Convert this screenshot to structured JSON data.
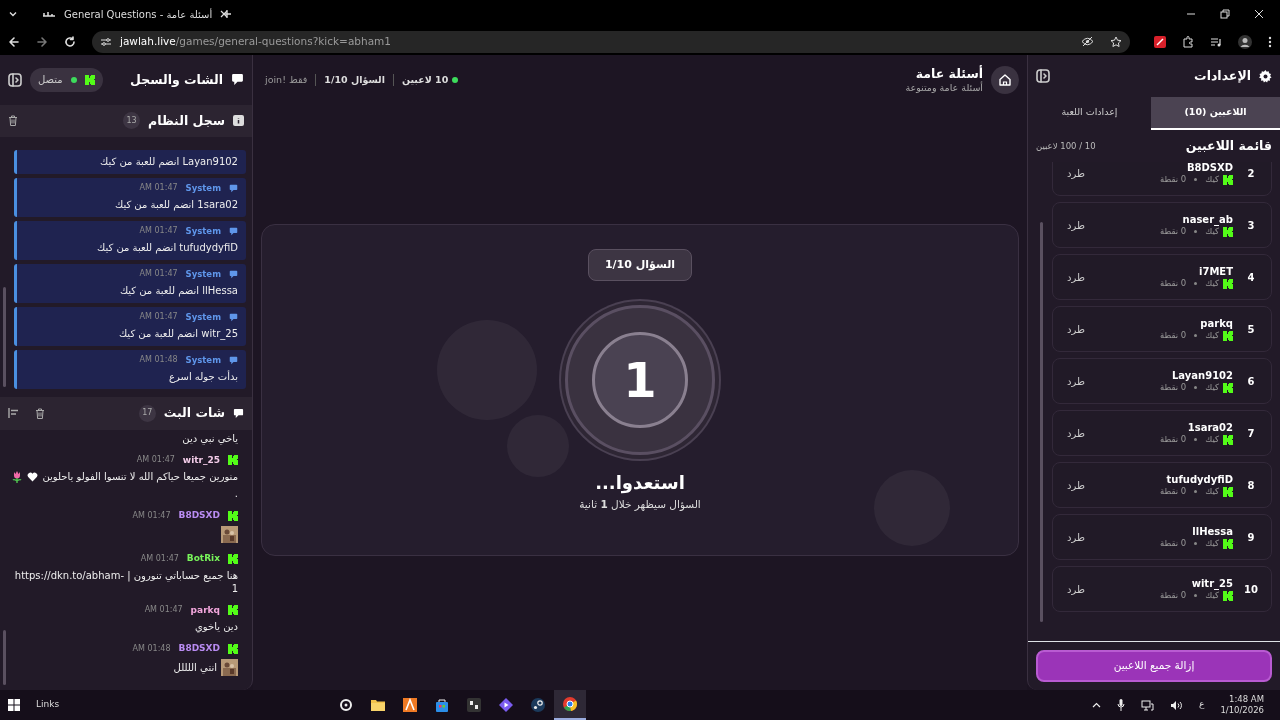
{
  "browser": {
    "tab_title": "General Questions - أسئلة عامة",
    "url_host": "jawlah.live",
    "url_path": "/games/general-questions?kick=abham1"
  },
  "chat_panel": {
    "title": "الشات والسجل",
    "status": {
      "label": "متصل",
      "online": true
    },
    "system_log": {
      "title": "سجل النظام",
      "count": "13",
      "entries": [
        {
          "text": "Layan9102 انضم للعبة من كيك"
        },
        {
          "sender": "System",
          "time": "01:47 AM",
          "text": "1sara02 انضم للعبة من كيك"
        },
        {
          "sender": "System",
          "time": "01:47 AM",
          "text": "tufudydyfiD انضم للعبة من كيك"
        },
        {
          "sender": "System",
          "time": "01:47 AM",
          "text": "llHessa انضم للعبة من كيك"
        },
        {
          "sender": "System",
          "time": "01:47 AM",
          "text": "witr_25 انضم للعبة من كيك"
        },
        {
          "sender": "System",
          "time": "01:48 AM",
          "text": "بدأت جوله اسرع"
        }
      ]
    },
    "stream_chat": {
      "title": "شات البث",
      "count": "17",
      "messages": [
        {
          "parts": [
            {
              "kind": "text",
              "text": "ياخي نبي دين"
            }
          ]
        },
        {
          "user": "witr_25",
          "color": "#f4cde9",
          "time": "01:47 AM",
          "parts": [
            {
              "kind": "text",
              "text": "منورين جميعا حياكم الله لا تنسوا الفولو ياحلوين"
            },
            {
              "kind": "heart-emote"
            },
            {
              "kind": "flower-emote"
            },
            {
              "kind": "text",
              "text": "."
            }
          ]
        },
        {
          "user": "B8DSXD",
          "color": "#b98cf2",
          "time": "01:47 AM",
          "parts": [
            {
              "kind": "image-emote"
            }
          ]
        },
        {
          "user": "BotRix",
          "color": "#78f55a",
          "time": "01:47 AM",
          "parts": [
            {
              "kind": "text",
              "text": "هنا جميع حساباتي تنورون | https://dkn.to/abham-1"
            }
          ]
        },
        {
          "user": "parkq",
          "color": "#f2a6dc",
          "time": "01:47 AM",
          "parts": [
            {
              "kind": "text",
              "text": "دين ياخوي"
            }
          ]
        },
        {
          "user": "B8DSXD",
          "color": "#b98cf2",
          "time": "01:48 AM",
          "parts": [
            {
              "kind": "image-emote"
            },
            {
              "kind": "text",
              "text": "انتي اللللل"
            }
          ]
        }
      ]
    }
  },
  "game": {
    "title": "أسئلة عامة",
    "subtitle": "أسئلة عامة ومتنوعة",
    "players_online": "10 لاعبين",
    "question": "السؤال 1/10",
    "join_hint": "فقط !join",
    "countdown": {
      "badge": "السؤال 1/10",
      "number": "1",
      "heading": "استعدوا...",
      "message": "السؤال سيظهر خلال **1** ثانية"
    }
  },
  "settings_panel": {
    "title": "الإعدادات",
    "tabs": [
      {
        "label": "اللاعبين (10)",
        "selected": true
      },
      {
        "label": "إعدادات اللعبة",
        "selected": false
      }
    ],
    "list_title": "قائمة اللاعبين",
    "capacity": "10 / 100 لاعبين",
    "players": [
      {
        "rank": "2",
        "name": "B8DSXD",
        "platform": "كيك",
        "points": "0 نقطة",
        "action": "طرد"
      },
      {
        "rank": "3",
        "name": "naser_ab",
        "platform": "كيك",
        "points": "0 نقطة",
        "action": "طرد"
      },
      {
        "rank": "4",
        "name": "i7MET",
        "platform": "كيك",
        "points": "0 نقطة",
        "action": "طرد"
      },
      {
        "rank": "5",
        "name": "parkq",
        "platform": "كيك",
        "points": "0 نقطة",
        "action": "طرد"
      },
      {
        "rank": "6",
        "name": "Layan9102",
        "platform": "كيك",
        "points": "0 نقطة",
        "action": "طرد"
      },
      {
        "rank": "7",
        "name": "1sara02",
        "platform": "كيك",
        "points": "0 نقطة",
        "action": "طرد"
      },
      {
        "rank": "8",
        "name": "tufudydyfiD",
        "platform": "كيك",
        "points": "0 نقطة",
        "action": "طرد"
      },
      {
        "rank": "9",
        "name": "llHessa",
        "platform": "كيك",
        "points": "0 نقطة",
        "action": "طرد"
      },
      {
        "rank": "10",
        "name": "witr_25",
        "platform": "كيك",
        "points": "0 نقطة",
        "action": "طرد"
      }
    ],
    "remove_all": "إزالة جميع اللاعبين"
  },
  "taskbar": {
    "links": "Links",
    "language": "ع",
    "time": "1:48 AM",
    "date": "1/10/2026"
  }
}
